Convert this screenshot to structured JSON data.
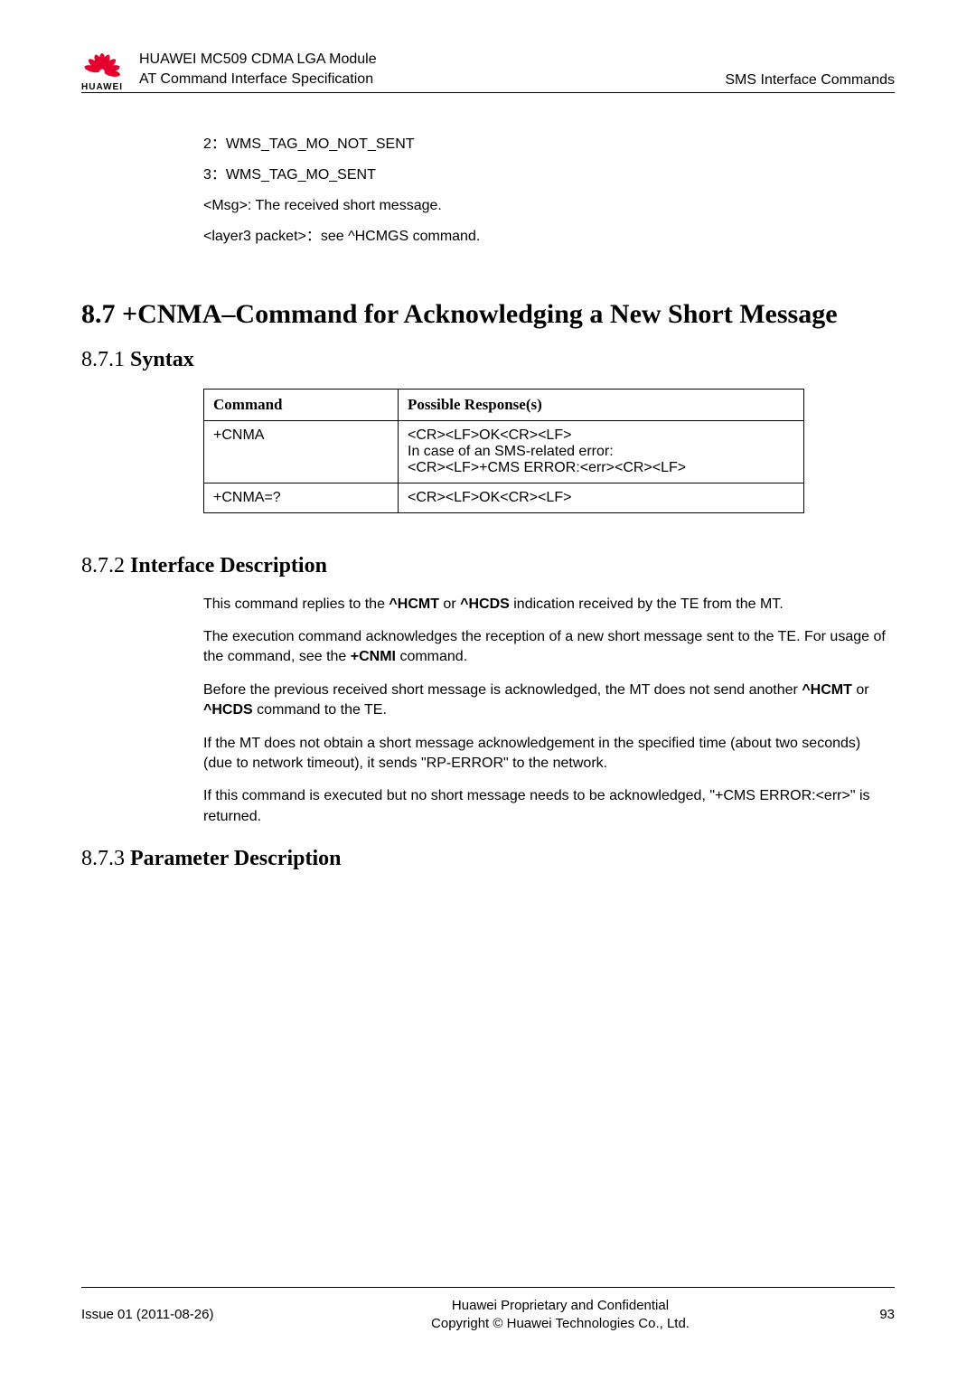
{
  "header": {
    "logo_text": "HUAWEI",
    "title_line1": "HUAWEI MC509 CDMA LGA Module",
    "title_line2": "AT Command Interface Specification",
    "right_text": "SMS Interface Commands"
  },
  "pre_content": {
    "line1": "2：WMS_TAG_MO_NOT_SENT",
    "line2": "3：WMS_TAG_MO_SENT",
    "line3": "<Msg>: The received short message.",
    "line4": "<layer3 packet>：see ^HCMGS command."
  },
  "section": {
    "heading": "8.7 +CNMA–Command for Acknowledging a New Short Message",
    "syntax": {
      "num": "8.7.1 ",
      "title": "Syntax",
      "table": {
        "col1_header": "Command",
        "col2_header": "Possible Response(s)",
        "rows": [
          {
            "cmd": "+CNMA",
            "resp_l1": "<CR><LF>OK<CR><LF>",
            "resp_l2": "In case of an SMS-related error:",
            "resp_l3": "<CR><LF>+CMS ERROR:<err><CR><LF>"
          },
          {
            "cmd": "+CNMA=?",
            "resp_l1": "<CR><LF>OK<CR><LF>"
          }
        ]
      }
    },
    "interface": {
      "num": "8.7.2 ",
      "title": "Interface Description",
      "p1_a": "This command replies to the ",
      "p1_b": "^HCMT",
      "p1_c": " or ",
      "p1_d": "^HCDS",
      "p1_e": " indication received by the TE from the MT.",
      "p2_a": "The execution command acknowledges the reception of a new short message sent to the TE. For usage of the command, see the ",
      "p2_b": "+CNMI",
      "p2_c": " command.",
      "p3_a": "Before the previous received short message is acknowledged, the MT does not send another ",
      "p3_b": "^HCMT",
      "p3_c": " or ",
      "p3_d": "^HCDS",
      "p3_e": " command to the TE.",
      "p4": "If the MT does not obtain a short message acknowledgement in the specified time (about two seconds) (due to network timeout), it sends \"RP-ERROR\" to the network.",
      "p5": "If this command is executed but no short message needs to be acknowledged, \"+CMS ERROR:<err>\" is returned."
    },
    "param": {
      "num": "8.7.3 ",
      "title": "Parameter Description"
    }
  },
  "footer": {
    "left": "Issue 01 (2011-08-26)",
    "center_l1": "Huawei Proprietary and Confidential",
    "center_l2": "Copyright © Huawei Technologies Co., Ltd.",
    "right": "93"
  }
}
